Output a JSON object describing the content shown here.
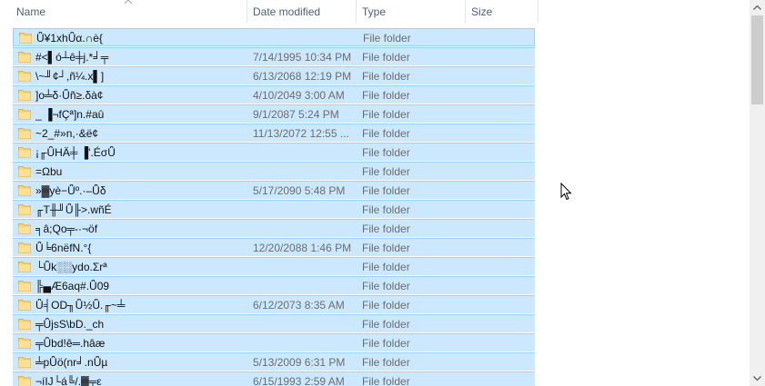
{
  "columns": {
    "name": "Name",
    "date_modified": "Date modified",
    "type": "Type",
    "size": "Size"
  },
  "sort": {
    "column": "name",
    "direction": "ascending",
    "icon": "chevron-up-icon"
  },
  "rows": [
    {
      "name": "Ǖ¥1xhǕα.∩è{",
      "date": "",
      "type": "File folder"
    },
    {
      "name": "#<▌ó┴ê╪j.*╛╤",
      "date": "7/14/1995 10:34 PM",
      "type": "File folder"
    },
    {
      "name": "\\~╜¢┘,ñ¼.x▌]",
      "date": "6/13/2068 12:19 PM",
      "type": "File folder"
    },
    {
      "name": "]o╧δ·Ǖñ≥.δà¢",
      "date": "4/10/2049 3:00 AM",
      "type": "File folder"
    },
    {
      "name": "_ ▐¬fÇª]n.#aû",
      "date": "9/1/2087 5:24 PM",
      "type": "File folder"
    },
    {
      "name": "~2_#»n,·&ë¢",
      "date": "11/13/2072 12:55 ...",
      "type": "File folder"
    },
    {
      "name": "¡╓ǕHÄ╪ ▐'.ÉσǕ",
      "date": "",
      "type": "File folder"
    },
    {
      "name": "=Ωbu",
      "date": "",
      "type": "File folder"
    },
    {
      "name": "»▓yè−Ǖº.·–Ǖδ",
      "date": "5/17/2090 5:48 PM",
      "type": "File folder"
    },
    {
      "name": "╓T╫╜Ǖ╟>.wñÉ",
      "date": "",
      "type": "File folder"
    },
    {
      "name": "╕â;Qo╤-·¬öf",
      "date": "",
      "type": "File folder"
    },
    {
      "name": "Ǖ╘6nëfN.°{",
      "date": "12/20/2088 1:46 PM",
      "type": "File folder"
    },
    {
      "name": "└Ǖk░░ydo.Σrª",
      "date": "",
      "type": "File folder"
    },
    {
      "name": "╠▄Æ6aq#.Ǖ09",
      "date": "",
      "type": "File folder"
    },
    {
      "name": "Ǖ╡OD╖Ǖ½Ǖ.╓~╧",
      "date": "6/12/2073 8:35 AM",
      "type": "File folder"
    },
    {
      "name": "╤ǕjsS\\bD._ch",
      "date": "",
      "type": "File folder"
    },
    {
      "name": "╤Ǖbd!ê═.hâæ",
      "date": "",
      "type": "File folder"
    },
    {
      "name": "╧pǕö(nr╛.nǕµ",
      "date": "5/13/2009 6:31 PM",
      "type": "File folder"
    },
    {
      "name": "¬íIJ└á╚/.▓╤ε",
      "date": "6/15/1993 2:59 AM",
      "type": "File folder"
    }
  ],
  "icons": {
    "folder": "folder-icon",
    "scroll_up": "scroll-up-arrow-icon",
    "scroll_down": "scroll-down-arrow-icon",
    "cursor": "mouse-cursor-icon"
  },
  "colors": {
    "selection_fill": "#cce8ff",
    "selection_border": "#99d1ff",
    "folder_yellow": "#f8d775",
    "header_text": "#4c607a",
    "secondary_text": "#6d6d6d"
  }
}
